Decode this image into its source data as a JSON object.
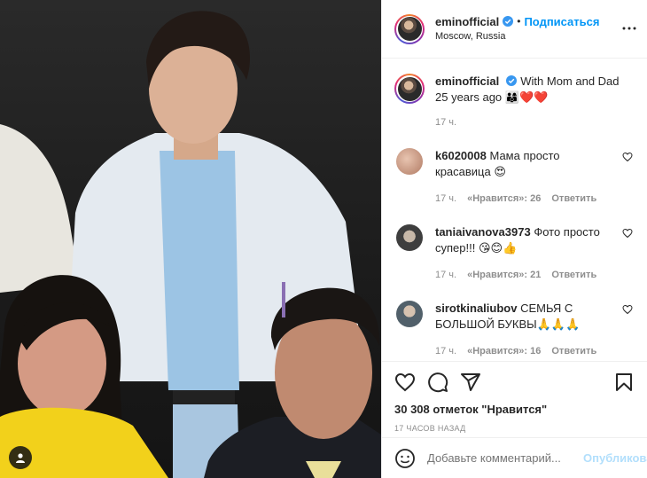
{
  "post": {
    "username": "eminofficial",
    "location": "Moscow, Russia",
    "follow_label": "Подписаться",
    "separator": "•",
    "caption": {
      "username": "eminofficial",
      "text": "With Mom and Dad 25 years ago 👨‍👩‍👦❤️❤️",
      "time": "17 ч."
    }
  },
  "comments": [
    {
      "username": "k6020008",
      "text": "Мама просто красавица 😍",
      "time": "17 ч.",
      "likes": "«Нравится»: 26",
      "reply": "Ответить",
      "avatar_color": "#c9a08a"
    },
    {
      "username": "taniaivanova3973",
      "text": "Фото просто супер!!! 😘😊👍",
      "time": "17 ч.",
      "likes": "«Нравится»: 21",
      "reply": "Ответить",
      "avatar_color": "#555a55"
    },
    {
      "username": "sirotkinaliubov",
      "text": "СЕМЬЯ С БОЛЬШОЙ БУКВЫ🙏🙏🙏",
      "time": "17 ч.",
      "likes": "«Нравится»: 16",
      "reply": "Ответить",
      "avatar_color": "#6f7d86"
    }
  ],
  "actions": {
    "likes_text": "30 308 отметок \"Нравится\"",
    "posted_ago": "17 ЧАСОВ НАЗАД"
  },
  "composer": {
    "placeholder": "Добавьте комментарий...",
    "publish_label": "Опубликовать"
  },
  "colors": {
    "accent": "#0095f6",
    "publish_disabled": "#b2dffc",
    "muted": "#8e8e8e",
    "heart_red": "#ed4956"
  },
  "icons": [
    "more-options-icon",
    "verified-badge-icon",
    "heart-icon",
    "comment-icon",
    "share-icon",
    "bookmark-icon",
    "emoji-icon",
    "tag-people-icon"
  ]
}
